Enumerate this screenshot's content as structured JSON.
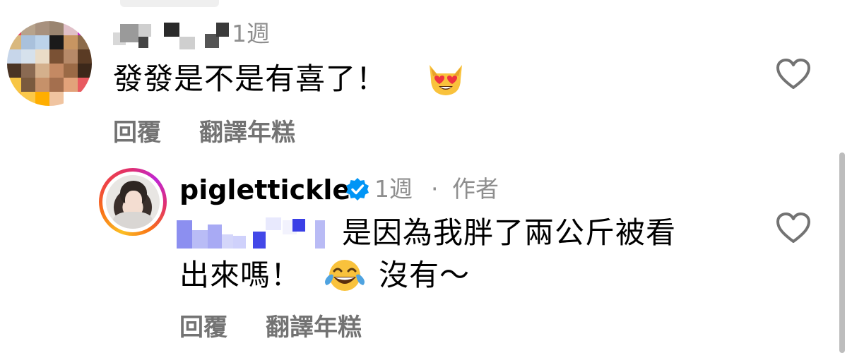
{
  "comment": {
    "time": "1週",
    "text": "發發是不是有喜了！",
    "emoji_icon": "smiling-cat-heart-eyes",
    "actions": {
      "reply": "回覆",
      "translate": "翻譯年糕"
    }
  },
  "reply": {
    "username": "piglettickle",
    "verified": true,
    "time": "1週",
    "separator": "·",
    "author_badge": "作者",
    "text_line1": "是因為我胖了兩公斤被看",
    "text_line2": "出來嗎！",
    "emoji_icon": "face-with-tears-of-joy",
    "text_after_emoji": "沒有～",
    "actions": {
      "reply": "回覆",
      "translate": "翻譯年糕"
    }
  },
  "colors": {
    "meta_gray": "#8e8e8e",
    "action_gray": "#737373",
    "verified_blue": "#0095f6"
  }
}
